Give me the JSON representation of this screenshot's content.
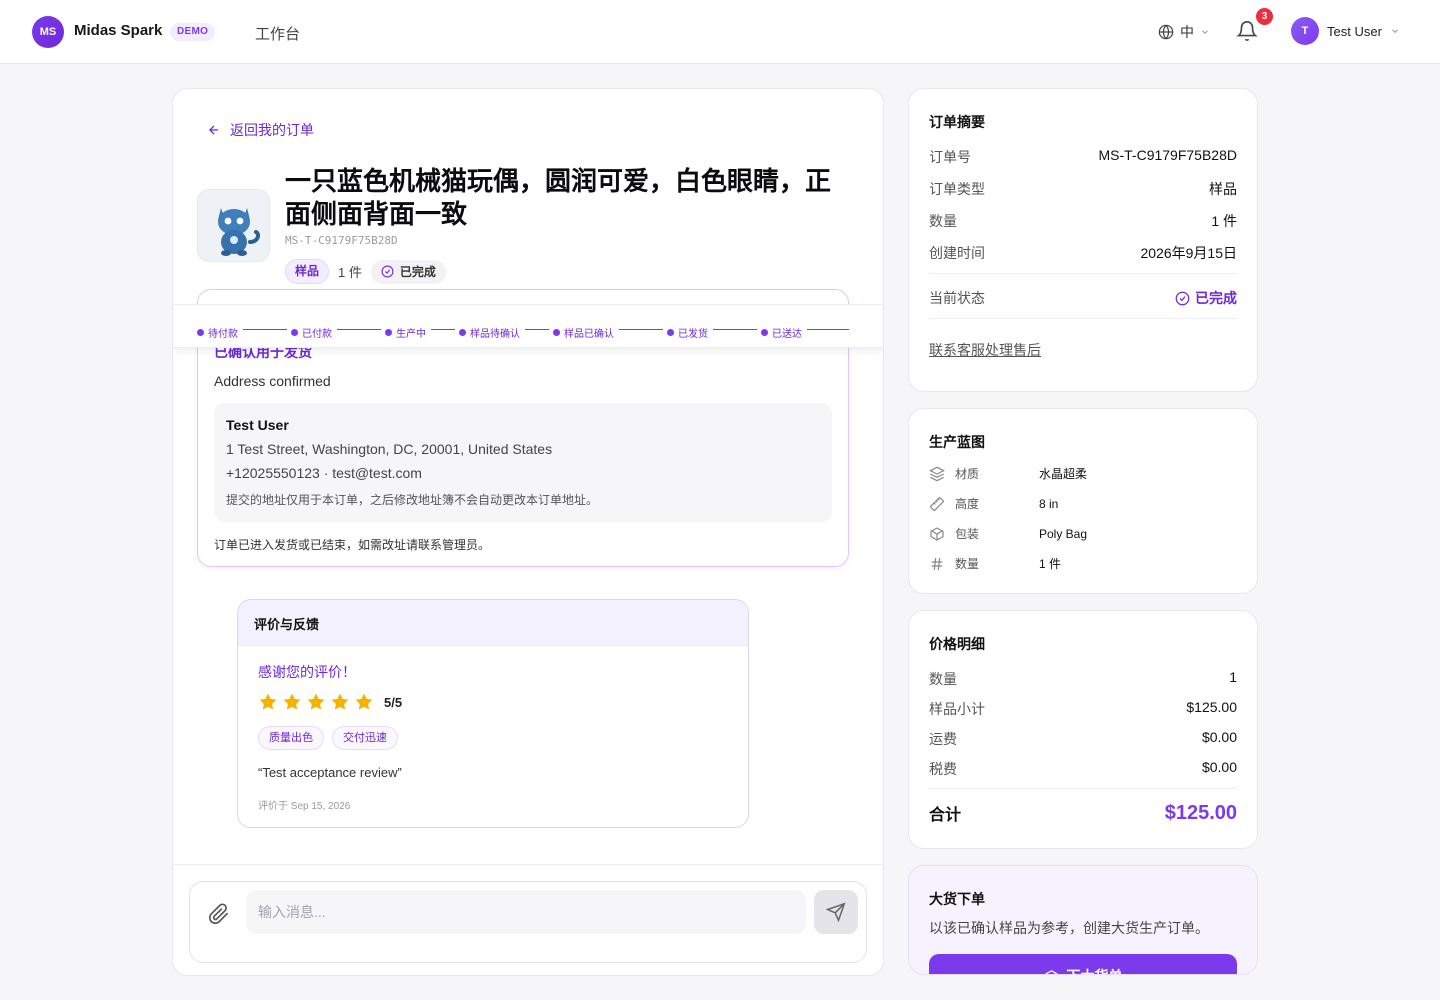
{
  "topbar": {
    "logo_initials": "MS",
    "brand": "Midas Spark",
    "badge": "DEMO",
    "nav_workspace": "工作台",
    "language": "中",
    "notification_count": "3",
    "user_initial": "T",
    "user_name": "Test User"
  },
  "order": {
    "back_label": "返回我的订单",
    "title": "一只蓝色机械猫玩偶，圆润可爱，白色眼睛，正面侧面背面一致",
    "id": "MS-T-C9179F75B28D",
    "type_chip": "样品",
    "qty": "1 件",
    "status_chip": "已完成"
  },
  "progress_steps": [
    "待付款",
    "已付款",
    "生产中",
    "样品待确认",
    "样品已确认",
    "已发货",
    "已送达"
  ],
  "address": {
    "heading": "已确认用于发货",
    "confirmed": "Address confirmed",
    "name": "Test User",
    "street": "1 Test Street, Washington, DC, 20001, United States",
    "contact": "+12025550123 · test@test.com",
    "note": "提交的地址仅用于本订单，之后修改地址簿不会自动更改本订单地址。",
    "footer": "订单已进入发货或已结束，如需改址请联系管理员。"
  },
  "review": {
    "heading": "评价与反馈",
    "thanks": "感谢您的评价！",
    "rating": 5,
    "score": "5/5",
    "tags": [
      "质量出色",
      "交付迅速"
    ],
    "quote": "“Test acceptance review”",
    "date": "评价于 Sep 15, 2026"
  },
  "composer": {
    "placeholder": "输入消息..."
  },
  "summary": {
    "title": "订单摘要",
    "rows": [
      {
        "k": "订单号",
        "v": "MS-T-C9179F75B28D"
      },
      {
        "k": "订单类型",
        "v": "样品"
      },
      {
        "k": "数量",
        "v": "1 件"
      },
      {
        "k": "创建时间",
        "v": "2026年9月15日"
      }
    ],
    "status_label": "当前状态",
    "status_value": "已完成",
    "service_link": "联系客服处理售后"
  },
  "blueprint": {
    "title": "生产蓝图",
    "rows": [
      {
        "icon": "layers-icon",
        "k": "材质",
        "v": "水晶超柔"
      },
      {
        "icon": "ruler-icon",
        "k": "高度",
        "v": "8 in"
      },
      {
        "icon": "box-icon",
        "k": "包装",
        "v": "Poly Bag"
      },
      {
        "icon": "hash-icon",
        "k": "数量",
        "v": "1 件"
      }
    ]
  },
  "pricing": {
    "title": "价格明细",
    "rows": [
      {
        "k": "数量",
        "v": "1"
      },
      {
        "k": "样品小计",
        "v": "$125.00"
      },
      {
        "k": "运费",
        "v": "$0.00"
      },
      {
        "k": "税费",
        "v": "$0.00"
      }
    ],
    "total_label": "合计",
    "total_value": "$125.00"
  },
  "bulk": {
    "title": "大货下单",
    "desc": "以该已确认样品为参考，创建大货生产订单。",
    "button": "下大货单"
  },
  "colors": {
    "accent": "#7c3aed",
    "badge_red": "#ef2d3f",
    "star": "#f5b301"
  }
}
